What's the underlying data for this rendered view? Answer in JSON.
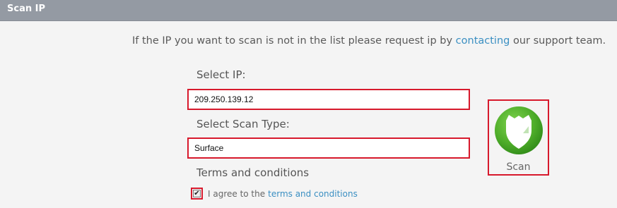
{
  "header": {
    "title": "Scan IP"
  },
  "notice": {
    "before": "If the IP you want to scan is not in the list please request ip by ",
    "link": "contacting",
    "after": " our support team."
  },
  "form": {
    "ip_label": "Select IP:",
    "ip_value": "209.250.139.12",
    "scan_type_label": "Select Scan Type:",
    "scan_type_value": "Surface",
    "terms_heading": "Terms and conditions",
    "agree_text": "I agree to the ",
    "agree_link": "terms and conditions",
    "agree_checked": true,
    "checkmark": "✔"
  },
  "scan_button": {
    "label": "Scan",
    "icon": "shield-icon",
    "color": "#4fae2a"
  },
  "colors": {
    "highlight": "#d7192c",
    "link": "#3a8fc2",
    "header": "#949aa3"
  }
}
